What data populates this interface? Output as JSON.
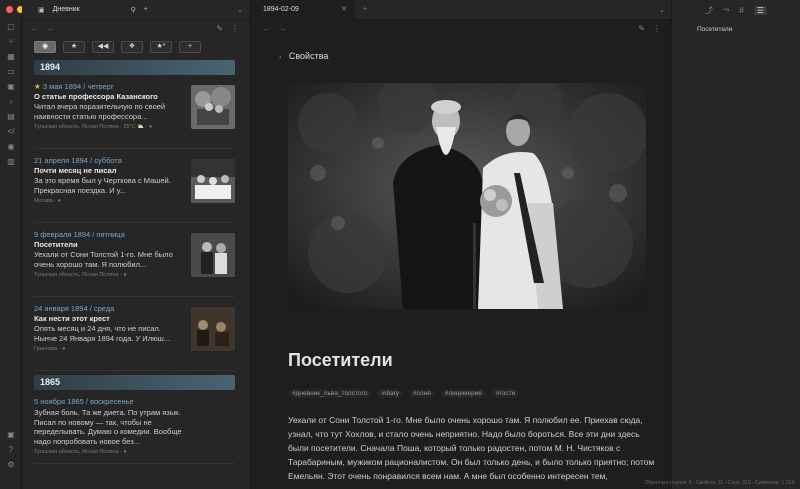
{
  "app": {
    "left_tab_title": "Дневник",
    "main_tab_title": "1894-02-09",
    "right_outline_item": "Посетители"
  },
  "colors": {
    "accent": "#7da7c8",
    "star": "#e8b63a",
    "year_banner": "#3c5362",
    "traffic_red": "#ff5f57",
    "traffic_yellow": "#febc2e",
    "traffic_green": "#28c840"
  },
  "filters": [
    {
      "icon": "◉",
      "active": true
    },
    {
      "icon": "★",
      "active": false
    },
    {
      "icon": "◀◀",
      "active": false
    },
    {
      "icon": "❖",
      "active": false
    },
    {
      "icon": "★*",
      "active": false
    },
    {
      "icon": "+",
      "active": false
    }
  ],
  "groups": [
    {
      "year": "1894",
      "entries": [
        {
          "date": "3 мая 1894 / четверг",
          "starred": true,
          "title": "О статье профессора Казанского",
          "text": "Читал вчера поразительную по своей наивности статью профессора...",
          "meta": "Тульская область, Ясная Поляна · 25°C ⛅ · ●"
        },
        {
          "date": "21 апреля 1894 / суббота",
          "starred": false,
          "title": "Почти месяц не писал",
          "text": "За это время был у Черткова с Машей. Прекрасная поездка. И у...",
          "meta": "Москва · ●"
        },
        {
          "date": "9 февраля 1894 / пятница",
          "starred": false,
          "title": "Посетители",
          "text": "Уехали от Сони Толстой 1-го. Мне было очень хорошо там. Я полюбил...",
          "meta": "Тульская область, Ясная Поляна · ●"
        },
        {
          "date": "24 января 1894 / среда",
          "starred": false,
          "title": "Как нести этот крест",
          "text": "Опять месяц и 24 дня, что не писал. Нынче 24 Января 1894 года. У Илюш...",
          "meta": "Гринчака · ●"
        }
      ]
    },
    {
      "year": "1865",
      "entries": [
        {
          "date": "5 ноября 1865 / воскресенье",
          "starred": false,
          "title": "",
          "text": "Зубная боль. Та же диета. По утрам язык. Писал по новому — так, чтобы не переделывать. Думаю о комедии. Вообще надо попробовать новое без...",
          "meta": "Тульская область, Ясная Поляна · ●"
        }
      ]
    }
  ],
  "note": {
    "properties_label": "Свойства",
    "title": "Посетители",
    "tags": [
      "#дневник_льва_толстого",
      "#diary",
      "#соня",
      "#лицемерие",
      "#гости"
    ],
    "body": "Уехали от Сони Толстой 1-го. Мне было очень хорошо там. Я полюбил ее. Приехав сюда, узнал, что тут Хохлов, и стало очень неприятно. Надо было бороться. Все эти дни здесь были посетители. Сначала Поша, который только радостен, потом М. Н. Чистяков с Тарабариным, мужиком рационалистом. Он был только день, и было только приятно; потом Емельян. Этот очень понравился всем нам. А мне был особенно интересен тем,"
  },
  "status": "Обратных ссылок: 0 · Свойств: 11 · Слов: 219 · Символов: 1 214"
}
